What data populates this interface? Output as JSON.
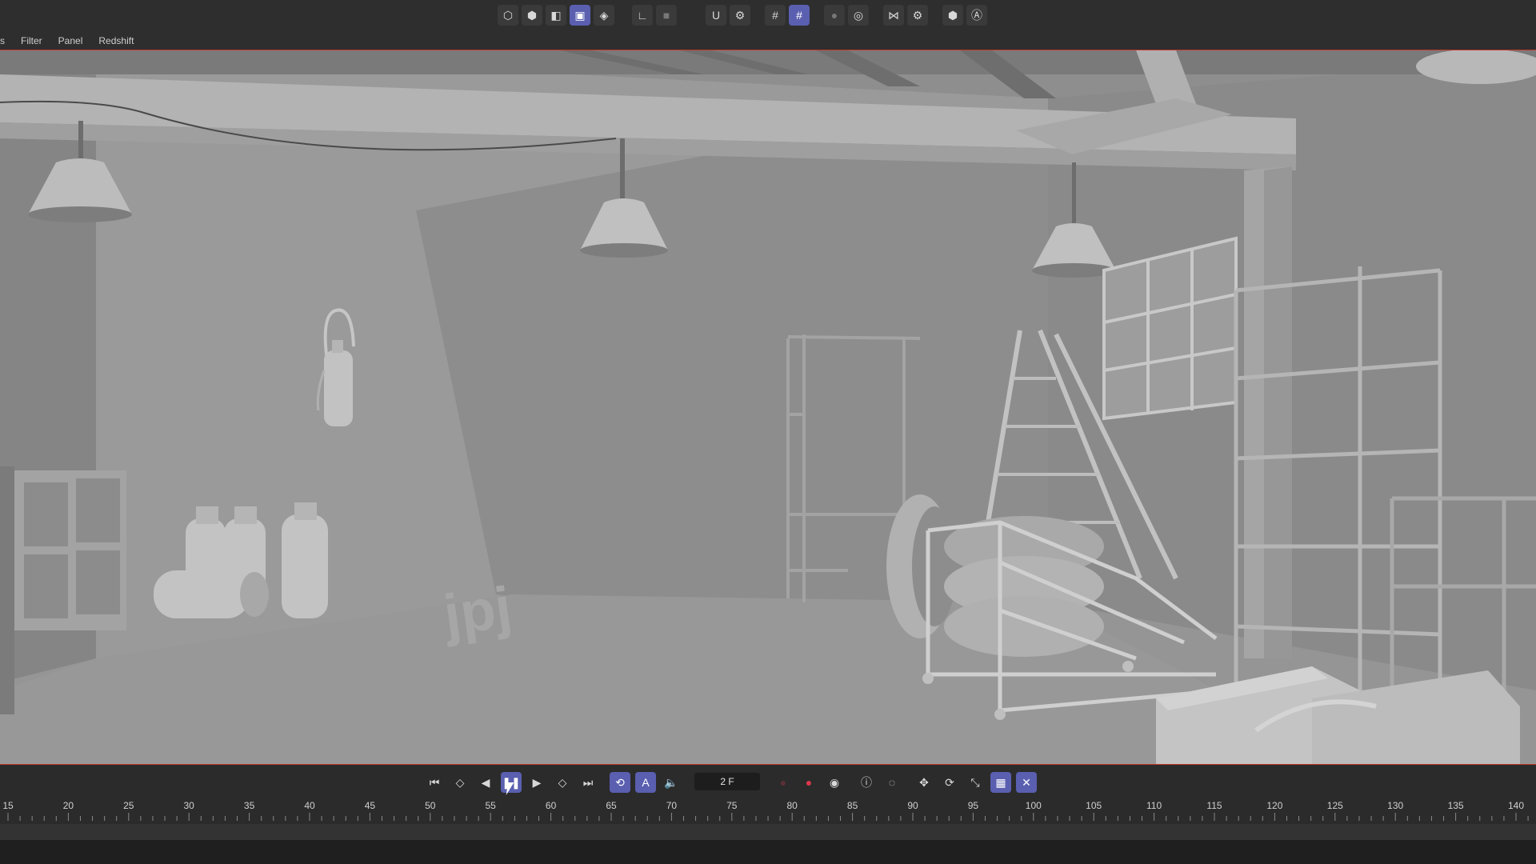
{
  "toolbar": {
    "groups": [
      {
        "icons": [
          "point-mode-icon",
          "edge-mode-icon",
          "polygon-mode-icon",
          "model-mode-icon",
          "texture-mode-icon"
        ]
      },
      {
        "icons": [
          "axis-icon",
          "solo-icon"
        ]
      },
      {
        "icons": [
          "snap-magnet-icon",
          "snap-settings-icon"
        ]
      },
      {
        "icons": [
          "grid-icon",
          "workplane-icon"
        ]
      },
      {
        "icons": [
          "render-region-icon",
          "render-settings-icon"
        ]
      },
      {
        "icons": [
          "symmetry-icon",
          "symmetry-settings-icon"
        ]
      },
      {
        "icons": [
          "hexagon-icon",
          "a-badge-icon"
        ]
      }
    ]
  },
  "menu": {
    "items": [
      "s",
      "Filter",
      "Panel",
      "Redshift"
    ]
  },
  "playback": {
    "frame_value": "2 F"
  },
  "timeline": {
    "ticks": [
      "15",
      "20",
      "25",
      "30",
      "35",
      "40",
      "45",
      "50",
      "55",
      "60",
      "65",
      "70",
      "75",
      "80",
      "85",
      "90",
      "95",
      "100",
      "105",
      "110",
      "115",
      "120",
      "125",
      "130",
      "135",
      "140"
    ]
  },
  "scene": {
    "logo_text": "jpj"
  },
  "colors": {
    "accent": "#5a5fb0",
    "record": "#d8394a",
    "viewport_bg": "#8f8f8f"
  }
}
